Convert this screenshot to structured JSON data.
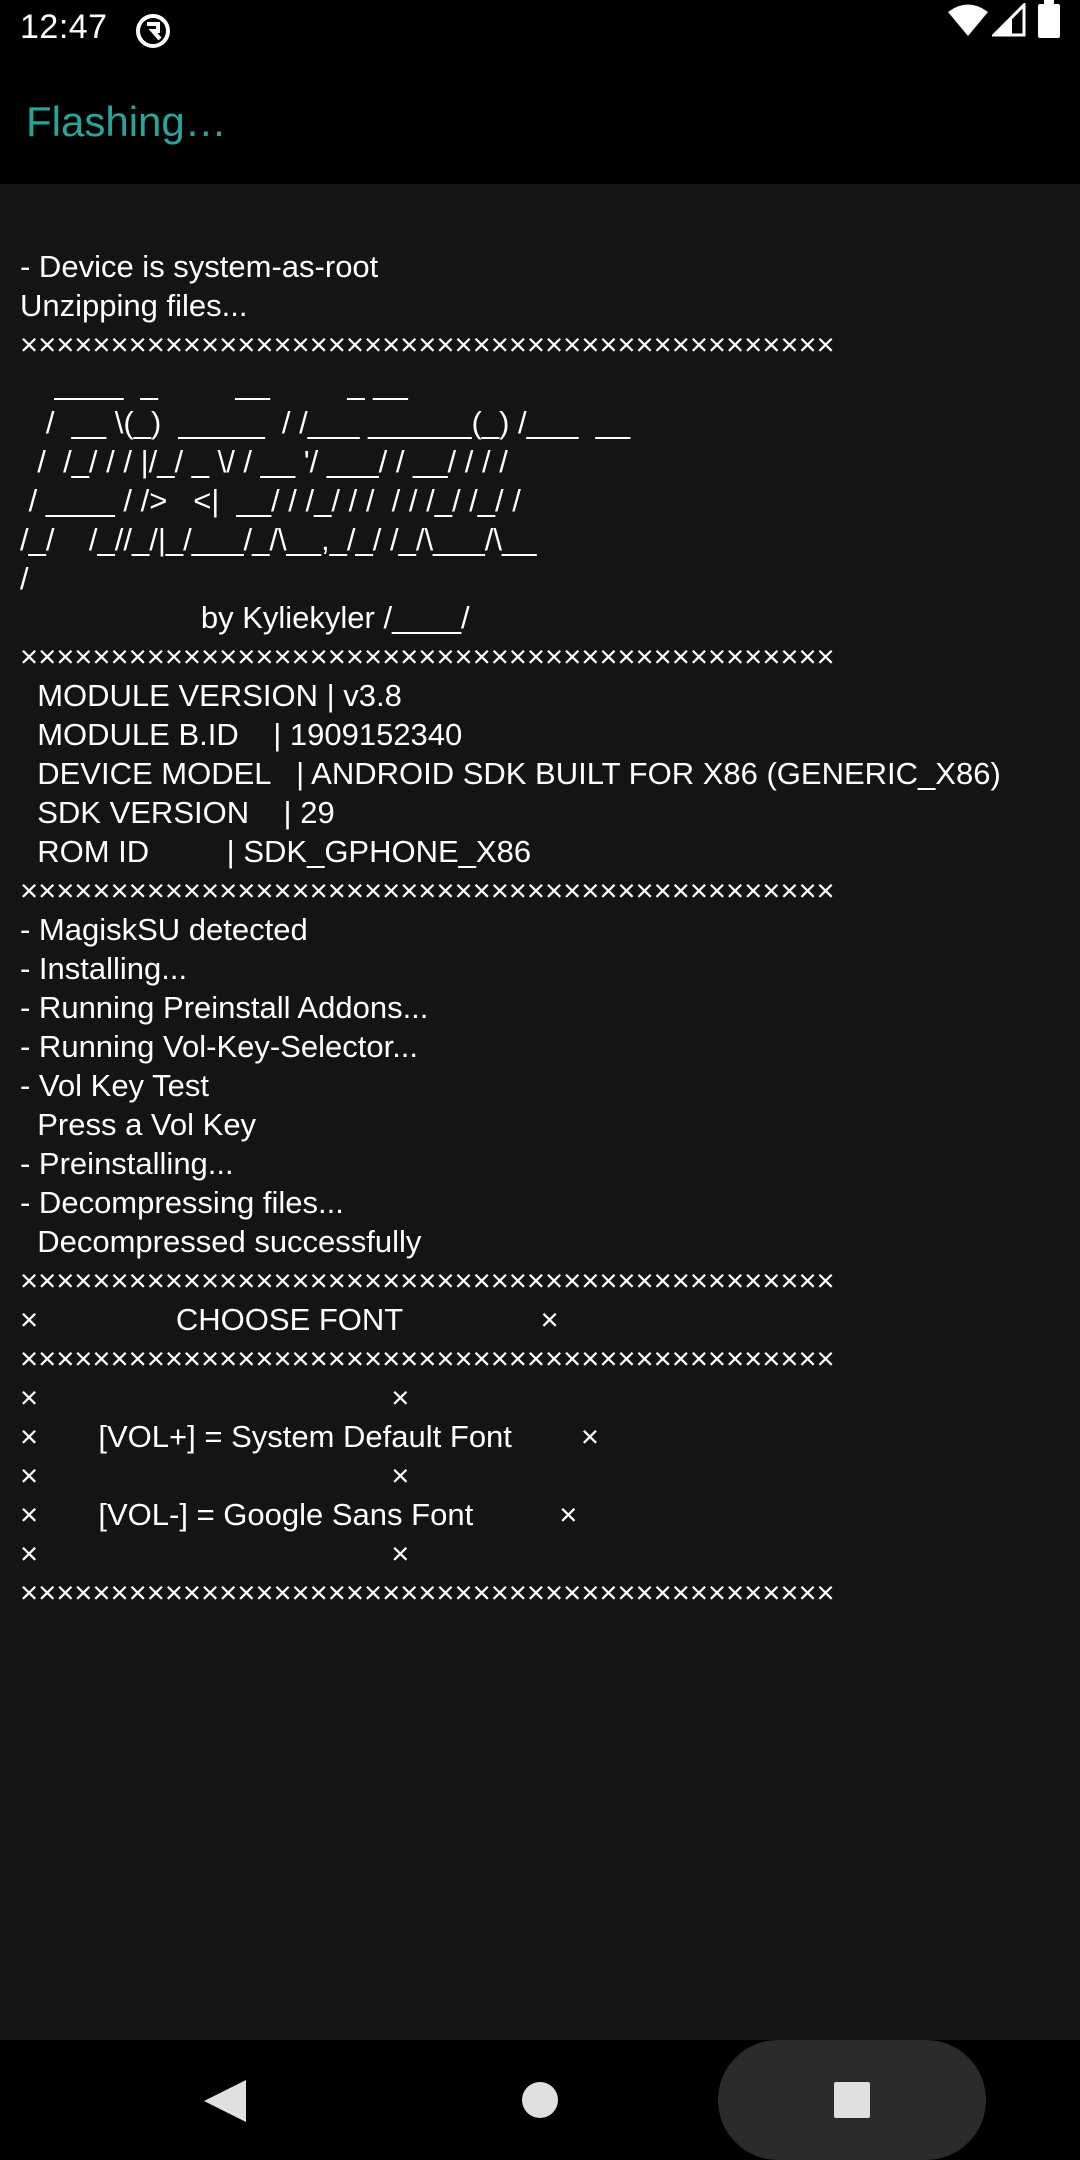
{
  "status_bar": {
    "time": "12:47",
    "icons": [
      "app-notification-icon",
      "wifi-icon",
      "signal-icon",
      "battery-icon"
    ]
  },
  "toolbar": {
    "title": "Flashing…"
  },
  "console": {
    "lines": [
      "- Device is system-as-root",
      "Unzipping files...",
      "×××××××××××××××××××××××××××××××××××××××××××××",
      "    ____  _         __         _ __",
      "   /  __ \\(_)  _____  / /___ ______(_) /___  __",
      "  /  /_/ / / |/_/ _ \\/ / __ '/ ___/ / __/ / / /",
      " / ____ / />   <|  __/ / /_/ / /  / / /_/ /_/ /",
      "/_/    /_//_/|_/___/_/\\__,_/_/ /_/\\___/\\__",
      "/",
      "                     by Kyliekyler /____/",
      "×××××××××××××××××××××××××××××××××××××××××××××",
      "  MODULE VERSION | v3.8",
      "  MODULE B.ID    | 1909152340",
      "  DEVICE MODEL   | ANDROID SDK BUILT FOR X86 (GENERIC_X86)",
      "  SDK VERSION    | 29",
      "  ROM ID         | SDK_GPHONE_X86",
      "×××××××××××××××××××××××××××××××××××××××××××××",
      "- MagiskSU detected",
      "- Installing...",
      "- Running Preinstall Addons...",
      "- Running Vol-Key-Selector...",
      "- Vol Key Test",
      "  Press a Vol Key",
      "- Preinstalling...",
      "- Decompressing files...",
      "  Decompressed successfully",
      "×××××××××××××××××××××××××××××××××××××××××××××",
      "×                CHOOSE FONT                ×",
      "×××××××××××××××××××××××××××××××××××××××××××××",
      "×                                         ×",
      "×       [VOL+] = System Default Font        ×",
      "×                                         ×",
      "×       [VOL-] = Google Sans Font          ×",
      "×                                         ×",
      "×××××××××××××××××××××××××××××××××××××××××××××"
    ]
  },
  "nav_bar": {
    "buttons": [
      "back",
      "home",
      "recents"
    ]
  },
  "colors": {
    "accent": "#26a69a",
    "background": "#141414",
    "bars": "#000000",
    "text": "#ffffff"
  }
}
